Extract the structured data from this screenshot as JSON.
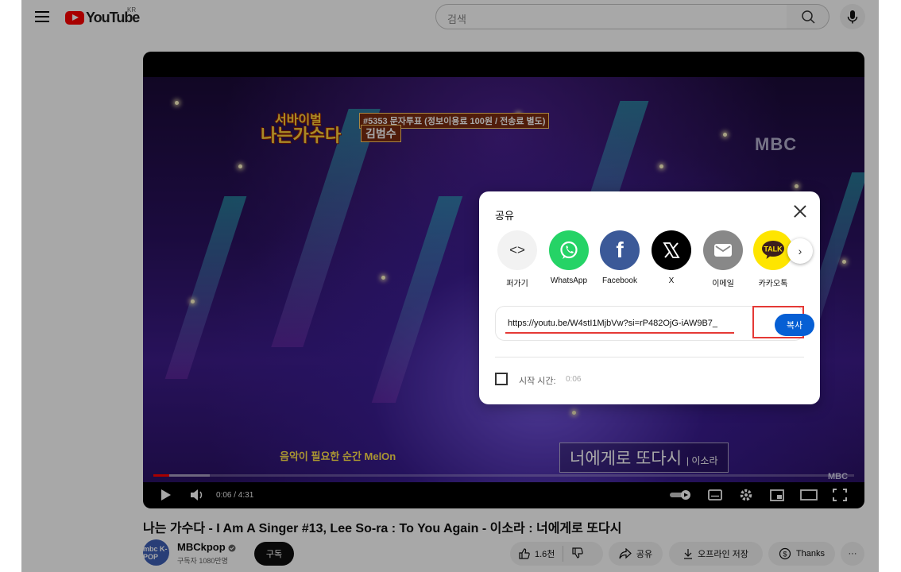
{
  "masthead": {
    "logo_text": "YouTube",
    "region": "KR",
    "search_placeholder": "검색"
  },
  "player": {
    "overlay": {
      "show_title_line1": "서바이벌",
      "show_title_line2": "나는가수다",
      "vote_tag": "#5353 문자투표 (정보이용료 100원 / 전송료 별도)",
      "singer_name": "김범수",
      "broadcaster": "MBC",
      "sponsor": "음악이 필요한 순간 MelOn",
      "lyric": "너에게로 또다시",
      "lyric_artist": "| 이소라"
    },
    "time": "0:06 / 4:31",
    "progress_fraction": 0.023,
    "buffer_fraction": 0.08
  },
  "video": {
    "title": "나는 가수다 - I Am A Singer #13, Lee So-ra : To You Again - 이소라 : 너에게로 또다시",
    "channel": {
      "avatar_text": "mbc K-POP",
      "name": "MBCkpop",
      "subscribers": "구독자 1080만명",
      "subscribe_label": "구독"
    },
    "actions": {
      "like_count": "1.6천",
      "share_label": "공유",
      "download_label": "오프라인 저장",
      "thanks_label": "Thanks",
      "more_label": "···"
    }
  },
  "share_dialog": {
    "title": "공유",
    "targets": [
      {
        "label": "퍼가기",
        "icon": "embed-icon",
        "color": "#f2f2f2"
      },
      {
        "label": "WhatsApp",
        "icon": "whatsapp-icon",
        "color": "#25d366"
      },
      {
        "label": "Facebook",
        "icon": "facebook-icon",
        "color": "#3b5998"
      },
      {
        "label": "X",
        "icon": "x-icon",
        "color": "#000000"
      },
      {
        "label": "이메일",
        "icon": "email-icon",
        "color": "#888888"
      },
      {
        "label": "카카오톡",
        "icon": "kakaotalk-icon",
        "color": "#fee500"
      }
    ],
    "url": "https://youtu.be/W4stI1MjbVw?si=rP482OjG-iAW9B7_",
    "copy_label": "복사",
    "start_time_label": "시작 시간:",
    "start_time_value": "0:06"
  },
  "colors": {
    "youtube_red": "#ff0000",
    "copy_blue": "#065fd4",
    "highlight_red": "#e53935"
  }
}
